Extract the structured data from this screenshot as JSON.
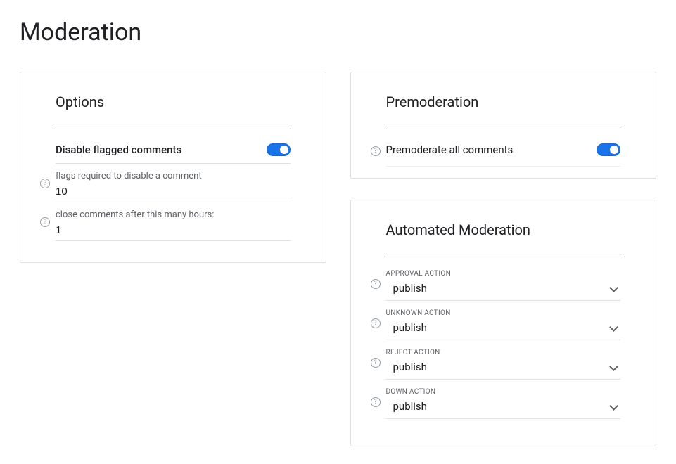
{
  "page": {
    "title": "Moderation"
  },
  "options": {
    "title": "Options",
    "disable_flagged_label": "Disable flagged comments",
    "disable_flagged_on": true,
    "flags_required": {
      "label": "flags required to disable a comment",
      "value": "10"
    },
    "close_after": {
      "label": "close comments after this many hours:",
      "value": "1"
    }
  },
  "premod": {
    "title": "Premoderation",
    "all_label": "Premoderate all comments",
    "all_on": true
  },
  "auto": {
    "title": "Automated Moderation",
    "approval": {
      "label": "APPROVAL ACTION",
      "value": "publish"
    },
    "unknown": {
      "label": "UNKNOWN ACTION",
      "value": "publish"
    },
    "reject": {
      "label": "REJECT ACTION",
      "value": "publish"
    },
    "down": {
      "label": "DOWN ACTION",
      "value": "publish"
    }
  }
}
